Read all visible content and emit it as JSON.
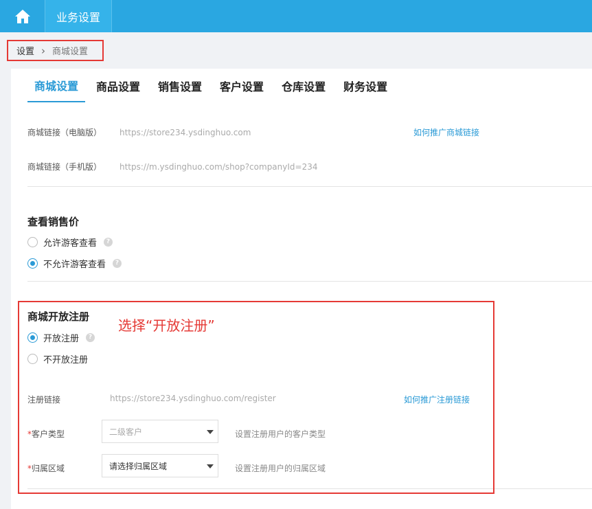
{
  "header": {
    "home_icon": "home-icon",
    "tab_label": "业务设置"
  },
  "breadcrumb": {
    "root": "设置",
    "current": "商城设置"
  },
  "tabs": [
    {
      "label": "商城设置",
      "active": true
    },
    {
      "label": "商品设置",
      "active": false
    },
    {
      "label": "销售设置",
      "active": false
    },
    {
      "label": "客户设置",
      "active": false
    },
    {
      "label": "仓库设置",
      "active": false
    },
    {
      "label": "财务设置",
      "active": false
    }
  ],
  "store_links": {
    "pc_label": "商城链接（电脑版）",
    "pc_url": "https://store234.ysdinghuo.com",
    "promote_link": "如何推广商城链接",
    "mobile_label": "商城链接（手机版）",
    "mobile_url": "https://m.ysdinghuo.com/shop?companyId=234"
  },
  "view_price": {
    "title": "查看销售价",
    "options": [
      {
        "label": "允许游客查看",
        "checked": false
      },
      {
        "label": "不允许游客查看",
        "checked": true
      }
    ]
  },
  "registration": {
    "title": "商城开放注册",
    "annotation": "选择“开放注册”",
    "options": [
      {
        "label": "开放注册",
        "checked": true
      },
      {
        "label": "不开放注册",
        "checked": false
      }
    ],
    "link_label": "注册链接",
    "link_url": "https://store234.ysdinghuo.com/register",
    "promote_link": "如何推广注册链接",
    "customer_type": {
      "required_mark": "*",
      "label": "客户类型",
      "value": "二级客户",
      "hint": "设置注册用户的客户类型"
    },
    "region": {
      "required_mark": "*",
      "label": "归属区域",
      "value": "请选择归属区域",
      "hint": "设置注册用户的归属区域"
    }
  },
  "colors": {
    "topbar": "#2aa7e1",
    "accent": "#2a9ad6",
    "annotation": "#e53935"
  }
}
